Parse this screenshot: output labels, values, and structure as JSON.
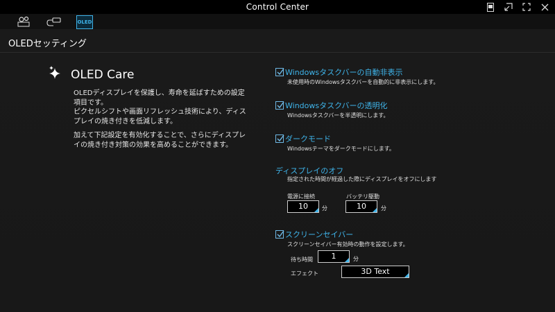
{
  "window": {
    "title": "Control Center"
  },
  "toolbar": {
    "tabs": [
      {
        "icon": "gear-monitor-icon"
      },
      {
        "icon": "usb-cable-icon"
      },
      {
        "icon": "oled-icon",
        "label": "OLED",
        "active": true
      }
    ]
  },
  "page": {
    "title": "OLEDセッティング"
  },
  "oled_care": {
    "title": "OLED Care",
    "desc1": "OLEDディスプレイを保護し、寿命を延ばすための設定\n項目です。\nピクセルシフトや画面リフレッシュ技術により、ディス\nプレイの焼き付きを低減します。",
    "desc2": "加えて下記設定を有効化することで、さらにディスプレ\nイの焼き付き対策の効果を高めることができます。"
  },
  "settings": {
    "taskbar_autohide": {
      "title": "Windowsタスクバーの自動非表示",
      "desc": "未使用時のWindowsタスクバーを自動的に非表示にします。",
      "checked": true
    },
    "taskbar_transparent": {
      "title": "Windowsタスクバーの透明化",
      "desc": "Windowsタスクバーを半透明にします。",
      "checked": true
    },
    "dark_mode": {
      "title": "ダークモード",
      "desc": "Windowsテーマをダークモードにします。",
      "checked": true
    },
    "display_off": {
      "title": "ディスプレイのオフ",
      "desc": "指定された時間が経過した際にディスプレイをオフにします",
      "ac_label": "電源に接続",
      "ac_value": "10",
      "battery_label": "バッテリ駆動",
      "battery_value": "10",
      "unit": "分"
    },
    "screensaver": {
      "title": "スクリーンセイバー",
      "desc": "スクリーンセイバー有効時の動作を設定します。",
      "checked": true,
      "wait_label": "待ち時間",
      "wait_value": "1",
      "unit": "分",
      "effect_label": "エフェクト",
      "effect_value": "3D Text"
    }
  },
  "colors": {
    "accent": "#3fb4ea",
    "background": "#181818",
    "titlebar": "#000000"
  }
}
